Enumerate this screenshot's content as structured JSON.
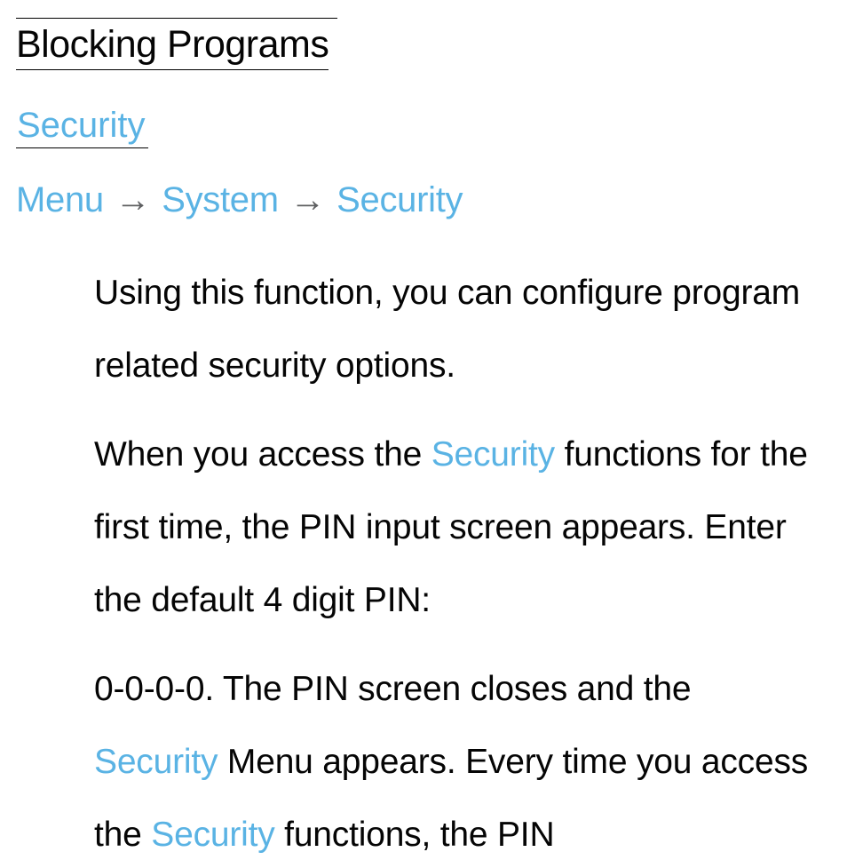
{
  "title": "Blocking Programs",
  "section_heading": "Security",
  "breadcrumb": {
    "items": [
      "Menu",
      "System",
      "Security"
    ],
    "separator": "→"
  },
  "paragraphs": {
    "p1": "Using this function, you can configure program related security options.",
    "p2a": "When you access the ",
    "p2_link": "Security",
    "p2b": " functions for the first time, the PIN input screen appears. Enter the default 4 digit PIN:",
    "p3a": "0-0-0-0. The PIN screen closes and the ",
    "p3_link1": "Security",
    "p3b": " Menu appears. Every time you access the ",
    "p3_link2": "Security",
    "p3c": " functions, the PIN"
  },
  "colors": {
    "link": "#5ab3e4",
    "separator": "#5f6062",
    "text": "#050505"
  }
}
